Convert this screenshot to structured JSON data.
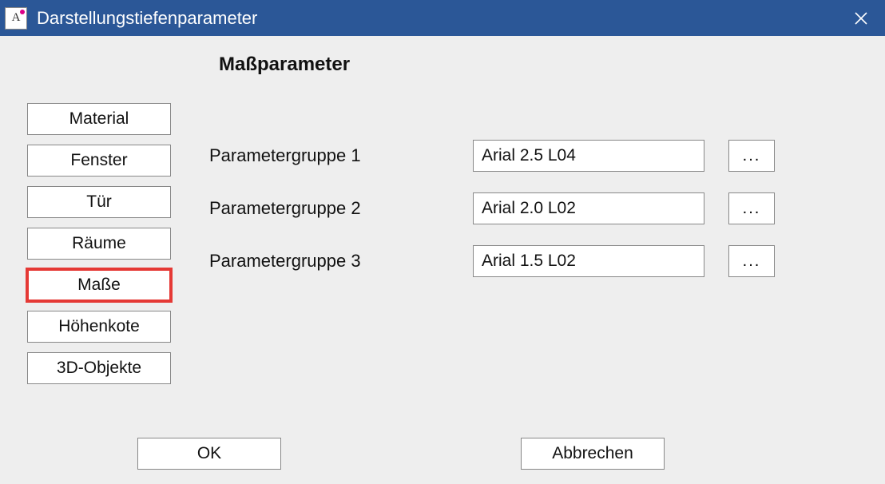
{
  "window": {
    "title": "Darstellungstiefenparameter",
    "app_icon_letter": "A"
  },
  "heading": "Maßparameter",
  "sidebar": {
    "items": [
      {
        "label": "Material",
        "highlight": false
      },
      {
        "label": "Fenster",
        "highlight": false
      },
      {
        "label": "Tür",
        "highlight": false
      },
      {
        "label": "Räume",
        "highlight": false
      },
      {
        "label": "Maße",
        "highlight": true
      },
      {
        "label": "Höhenkote",
        "highlight": false
      },
      {
        "label": "3D-Objekte",
        "highlight": false
      }
    ]
  },
  "params": {
    "rows": [
      {
        "label": "Parametergruppe 1",
        "value": "Arial 2.5 L04",
        "browse": "..."
      },
      {
        "label": "Parametergruppe 2",
        "value": "Arial 2.0 L02",
        "browse": "..."
      },
      {
        "label": "Parametergruppe 3",
        "value": "Arial 1.5 L02",
        "browse": "..."
      }
    ]
  },
  "footer": {
    "ok": "OK",
    "cancel": "Abbrechen"
  }
}
